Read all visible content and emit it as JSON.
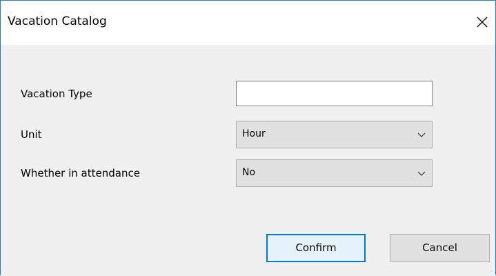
{
  "window": {
    "title": "Vacation Catalog"
  },
  "form": {
    "vacation_type": {
      "label": "Vacation Type",
      "value": ""
    },
    "unit": {
      "label": "Unit",
      "value": "Hour"
    },
    "attendance": {
      "label": "Whether in attendance",
      "value": "No"
    }
  },
  "buttons": {
    "confirm": "Confirm",
    "cancel": "Cancel"
  },
  "icons": {
    "close": "close-icon",
    "dropdown": "chevron-down-icon"
  },
  "colors": {
    "accent": "#0078d7",
    "window_border": "#2b79c6",
    "client_bg": "#f0f0f0"
  }
}
